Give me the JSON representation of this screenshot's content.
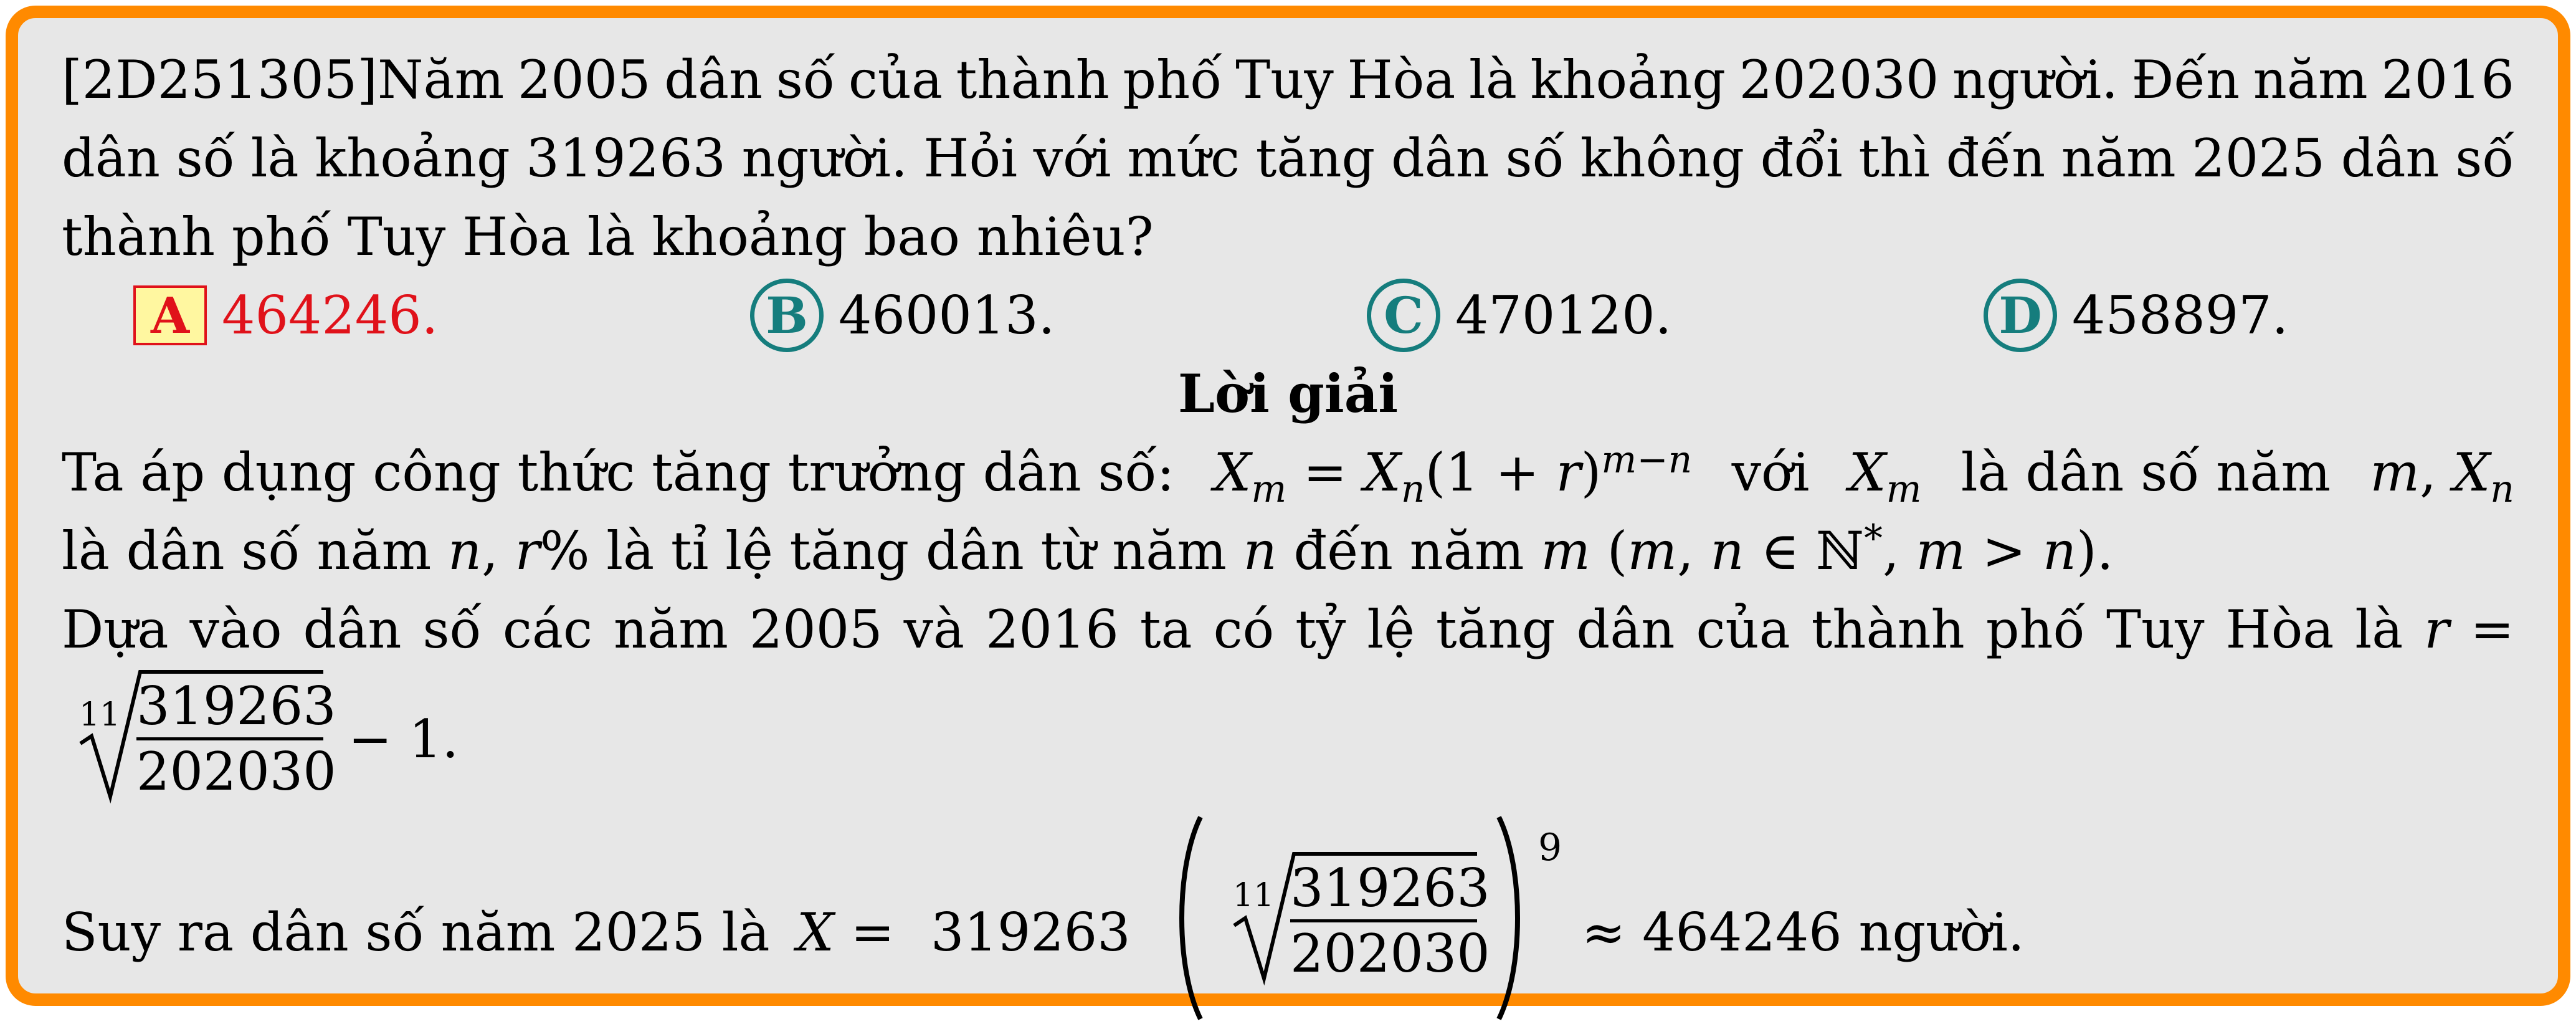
{
  "problem": {
    "line1": [
      "[2D251305]Năm",
      "2005",
      "dân",
      "số",
      "của",
      "thành",
      "phố",
      "Tuy",
      "Hòa",
      "là",
      "khoảng",
      "202030",
      "người.",
      "Đến",
      "năm",
      "2016"
    ],
    "line2": [
      "dân",
      "số",
      "là",
      "khoảng",
      "319263",
      "người.",
      "Hỏi",
      "với",
      "mức",
      "tăng",
      "dân",
      "số",
      "không",
      "đổi",
      "thì",
      "đến",
      "năm",
      "2025",
      "dân",
      "số"
    ],
    "line3": "thành phố Tuy Hòa là khoảng bao nhiêu?"
  },
  "options": [
    {
      "label": "A",
      "value": "464246.",
      "correct": true
    },
    {
      "label": "B",
      "value": "460013.",
      "correct": false
    },
    {
      "label": "C",
      "value": "470120.",
      "correct": false
    },
    {
      "label": "D",
      "value": "458897.",
      "correct": false
    }
  ],
  "solution": {
    "heading": "Lời giải",
    "s1_text1": "Ta áp dụng công thức tăng trưởng dân số:",
    "s1_text2": "với",
    "s1_text3": "là dân số năm",
    "s2_text1": "là dân số năm",
    "s2_text2": "là tỉ lệ tăng dân từ năm",
    "s2_text3": "đến năm",
    "s3_text": "Dựa vào dân số các năm 2005 và 2016 ta có tỷ lệ tăng dân của thành phố Tuy Hòa là",
    "root_index": "11",
    "numerator": "319263",
    "denominator": "202030",
    "minus_one": "− 1.",
    "s5_text1": "Suy ra dân số năm 2025 là",
    "s5_coef": "319263",
    "s5_exp": "9",
    "s5_text2": "≈ 464246 người."
  }
}
